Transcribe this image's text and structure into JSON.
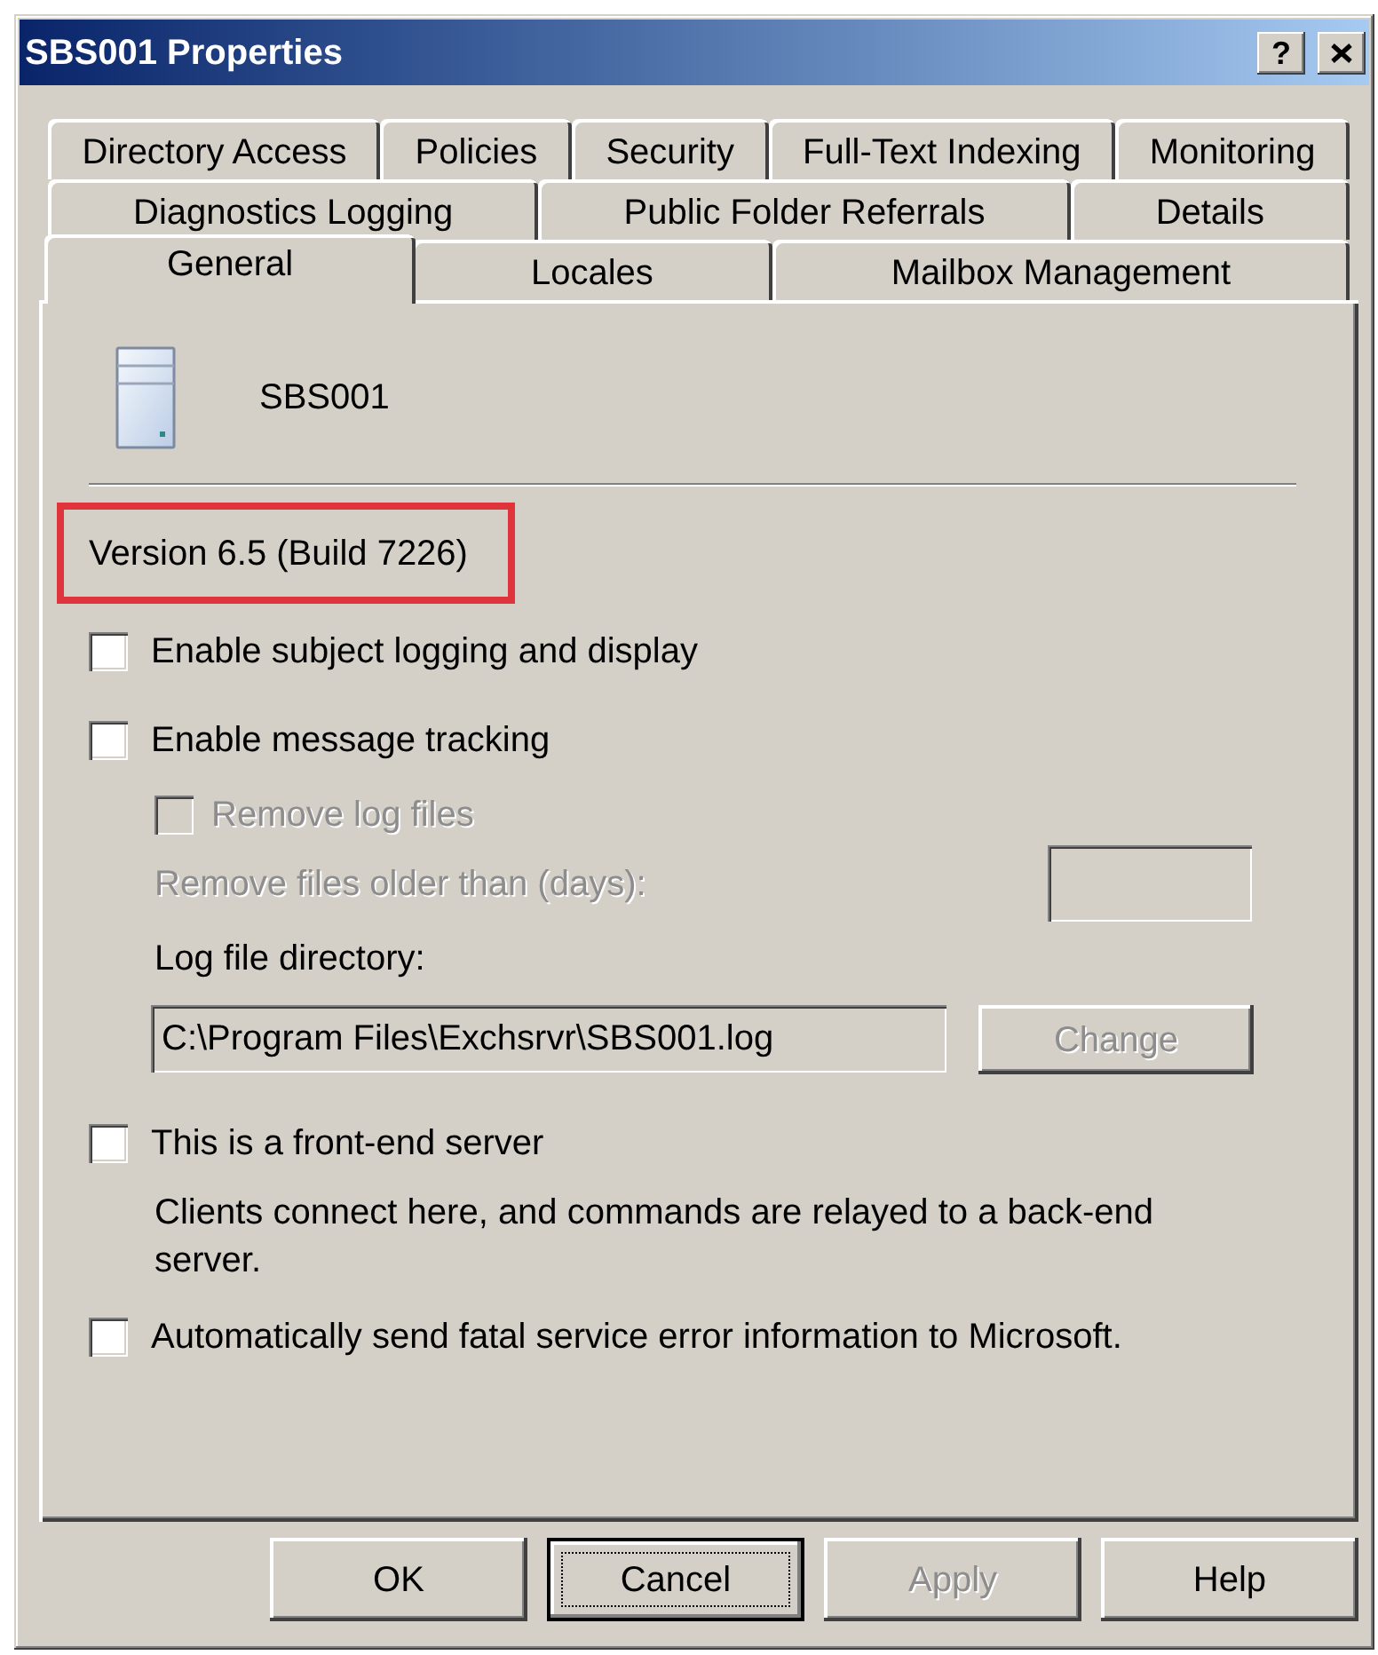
{
  "window": {
    "title": "SBS001 Properties",
    "title_buttons": [
      {
        "kind": "help",
        "label": "?"
      },
      {
        "kind": "close"
      }
    ]
  },
  "tab_rows": [
    {
      "tabs": [
        {
          "label": "Directory Access",
          "selected": false
        },
        {
          "label": "Policies",
          "selected": false
        },
        {
          "label": "Security",
          "selected": false
        },
        {
          "label": "Full-Text Indexing",
          "selected": false
        },
        {
          "label": "Monitoring",
          "selected": false
        }
      ]
    },
    {
      "tabs": [
        {
          "label": "Diagnostics Logging",
          "selected": false
        },
        {
          "label": "Public Folder Referrals",
          "selected": false
        },
        {
          "label": "Details",
          "selected": false
        }
      ]
    },
    {
      "tabs": [
        {
          "label": "General",
          "selected": true
        },
        {
          "label": "Locales",
          "selected": false
        },
        {
          "label": "Mailbox Management",
          "selected": false
        }
      ]
    }
  ],
  "general": {
    "server": {
      "name": "SBS001"
    },
    "version": {
      "text": "Version 6.5 (Build 7226)",
      "highlighted": true
    },
    "subject_logging": {
      "label": "Enable subject logging and display",
      "checked": false,
      "disabled": false
    },
    "message_tracking": {
      "label": "Enable message tracking",
      "checked": false,
      "disabled": false
    },
    "remove_log_files": {
      "label": "Remove log files",
      "checked": false,
      "disabled": true
    },
    "remove_older_than": {
      "label": "Remove files older than (days):",
      "disabled": true
    },
    "log_directory": {
      "label": "Log file directory:",
      "value": "C:\\Program Files\\Exchsrvr\\SBS001.log",
      "read_only": true
    },
    "change_button": {
      "label": "Change",
      "disabled": true
    },
    "front_end": {
      "label": "This is a front-end server",
      "checked": false,
      "disabled": false,
      "description": "Clients connect here, and commands are relayed to a back-end server."
    },
    "error_reporting": {
      "label": "Automatically send fatal service error information to Microsoft.",
      "checked": false,
      "disabled": false
    }
  },
  "buttons": [
    {
      "label": "OK",
      "disabled": false,
      "focused": false
    },
    {
      "label": "Cancel",
      "disabled": false,
      "focused": true
    },
    {
      "label": "Apply",
      "disabled": true,
      "focused": false
    },
    {
      "label": "Help",
      "disabled": false,
      "focused": false
    }
  ]
}
